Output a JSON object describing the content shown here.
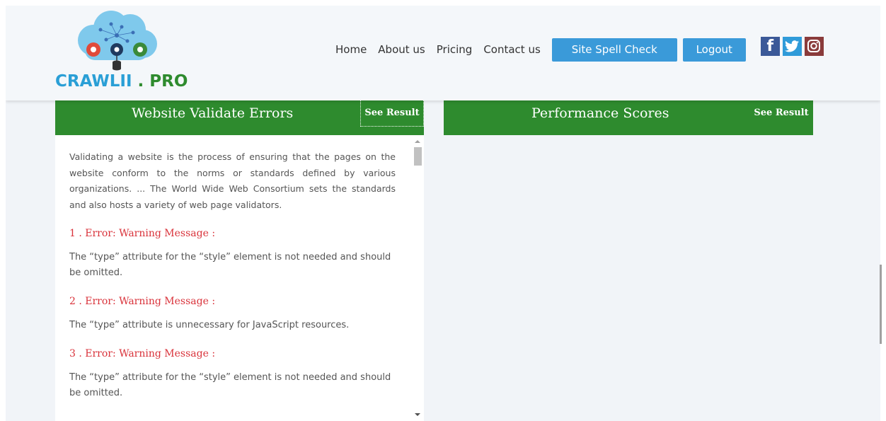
{
  "brand": {
    "logo_text_part1": "CRAWLII",
    "logo_text_sep": " . ",
    "logo_text_part2": "PRO",
    "logo_icon": "cloud-network-database-icon",
    "colors": {
      "blue": "#2a9fd6",
      "green": "#2e8b2e"
    }
  },
  "nav": {
    "links": [
      "Home",
      "About us",
      "Pricing",
      "Contact us"
    ],
    "spell_check_label": "Site Spell Check",
    "logout_label": "Logout",
    "social": [
      {
        "name": "facebook-icon",
        "glyph": "f"
      },
      {
        "name": "twitter-icon"
      },
      {
        "name": "instagram-icon"
      }
    ],
    "button_color": "#3a9ad9"
  },
  "validate_panel": {
    "title": "Website Validate Errors",
    "see_result_label": "See Result",
    "intro": "Validating a website is the process of ensuring that the pages on the website conform to the norms or standards defined by various organizations. ... The World Wide Web Consortium sets the standards and also hosts a variety of web page validators.",
    "errors": [
      {
        "title": "1 . Error: Warning Message :",
        "message": "The “type” attribute for the “style” element is not needed and should be omitted."
      },
      {
        "title": "2 . Error: Warning Message :",
        "message": "The “type” attribute is unnecessary for JavaScript resources."
      },
      {
        "title": "3 . Error: Warning Message :",
        "message": "The “type” attribute for the “style” element is not needed and should be omitted."
      }
    ],
    "header_color": "#2e8b2e",
    "error_color": "#d9323a"
  },
  "performance_panel": {
    "title": "Performance Scores",
    "see_result_label": "See Result"
  }
}
